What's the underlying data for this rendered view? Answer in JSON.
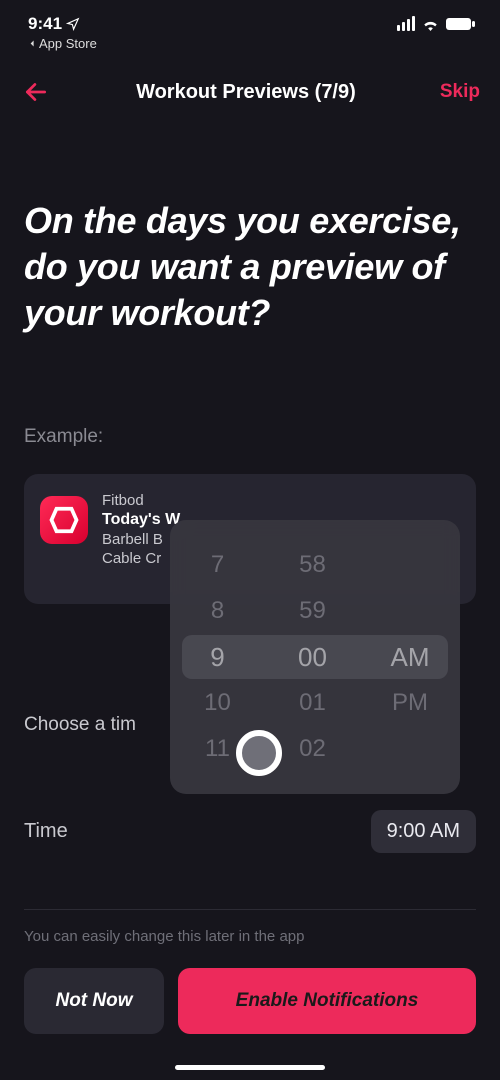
{
  "status": {
    "time": "9:41",
    "back_app": "App Store"
  },
  "nav": {
    "title": "Workout Previews (7/9)",
    "skip": "Skip"
  },
  "headline": "On the days you exercise, do you want a preview of your workout?",
  "example_label": "Example:",
  "card": {
    "app": "Fitbod",
    "title": "Today's W",
    "line1": "Barbell B",
    "line2": "Cable Cr"
  },
  "choose_label": "Choose a tim",
  "time_section": {
    "label": "Time",
    "value": "9:00 AM"
  },
  "hint": "You can easily change this later in the app",
  "buttons": {
    "not_now": "Not Now",
    "enable": "Enable Notifications"
  },
  "picker": {
    "hours": [
      "7",
      "8",
      "9",
      "10",
      "11"
    ],
    "minutes": [
      "58",
      "59",
      "00",
      "01",
      "02"
    ],
    "ampm": [
      "AM",
      "PM"
    ],
    "selected_hour": "9",
    "selected_minute": "00",
    "selected_ampm": "AM"
  },
  "colors": {
    "accent": "#ed2a5b"
  }
}
